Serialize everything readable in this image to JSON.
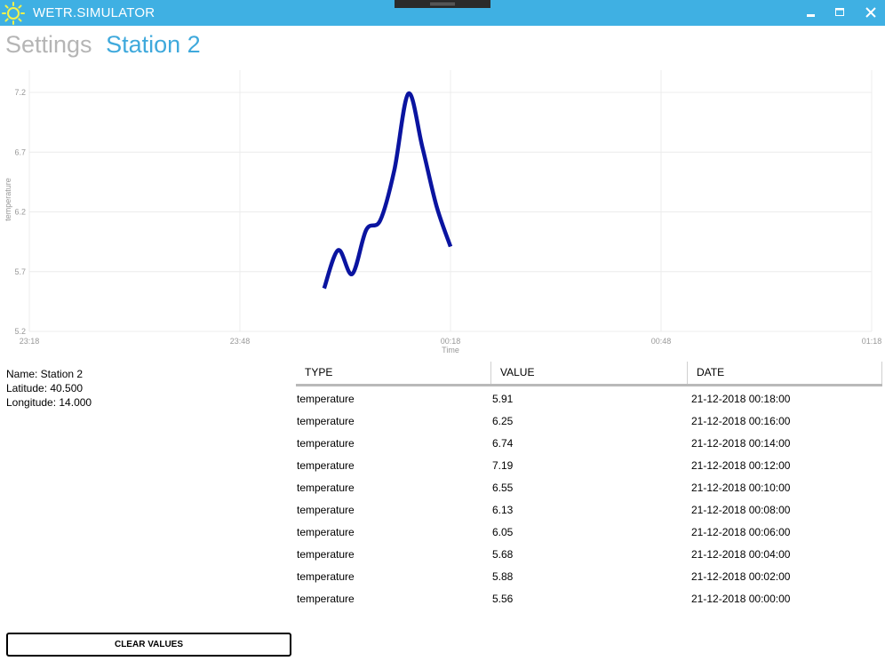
{
  "window": {
    "title": "WETR.SIMULATOR",
    "controls": {
      "minimize": "minimize",
      "maximize": "maximize",
      "close": "close"
    }
  },
  "header": {
    "settings_label": "Settings",
    "station_label": "Station 2"
  },
  "station_info": {
    "name_line": "Name: Station 2",
    "latitude_line": "Latitude: 40.500",
    "longitude_line": "Longitude: 14.000"
  },
  "table": {
    "columns": [
      "TYPE",
      "VALUE",
      "DATE"
    ],
    "rows": [
      {
        "type": "temperature",
        "value": "5.91",
        "date": "21-12-2018 00:18:00"
      },
      {
        "type": "temperature",
        "value": "6.25",
        "date": "21-12-2018 00:16:00"
      },
      {
        "type": "temperature",
        "value": "6.74",
        "date": "21-12-2018 00:14:00"
      },
      {
        "type": "temperature",
        "value": "7.19",
        "date": "21-12-2018 00:12:00"
      },
      {
        "type": "temperature",
        "value": "6.55",
        "date": "21-12-2018 00:10:00"
      },
      {
        "type": "temperature",
        "value": "6.13",
        "date": "21-12-2018 00:08:00"
      },
      {
        "type": "temperature",
        "value": "6.05",
        "date": "21-12-2018 00:06:00"
      },
      {
        "type": "temperature",
        "value": "5.68",
        "date": "21-12-2018 00:04:00"
      },
      {
        "type": "temperature",
        "value": "5.88",
        "date": "21-12-2018 00:02:00"
      },
      {
        "type": "temperature",
        "value": "5.56",
        "date": "21-12-2018 00:00:00"
      }
    ]
  },
  "clear_button_label": "CLEAR VALUES",
  "colors": {
    "accent": "#3fb0e3",
    "line": "#0a14a0",
    "settings_text": "#b5b5b5",
    "station_text": "#3fa9dc"
  },
  "chart_data": {
    "type": "line",
    "xlabel": "Time",
    "ylabel": "temperature",
    "x_ticks": [
      "23:18",
      "23:48",
      "00:18",
      "00:48",
      "01:18"
    ],
    "y_ticks": [
      "5.2",
      "5.7",
      "6.2",
      "6.7",
      "7.2"
    ],
    "ylim": [
      5.2,
      7.2
    ],
    "xlim": [
      "23:18",
      "01:18"
    ],
    "grid": true,
    "series": [
      {
        "x": [
          "00:00",
          "00:02",
          "00:04",
          "00:06",
          "00:08",
          "00:10",
          "00:12",
          "00:14",
          "00:16",
          "00:18"
        ],
        "values": [
          5.56,
          5.88,
          5.68,
          6.05,
          6.13,
          6.55,
          7.19,
          6.74,
          6.25,
          5.91
        ]
      }
    ]
  }
}
